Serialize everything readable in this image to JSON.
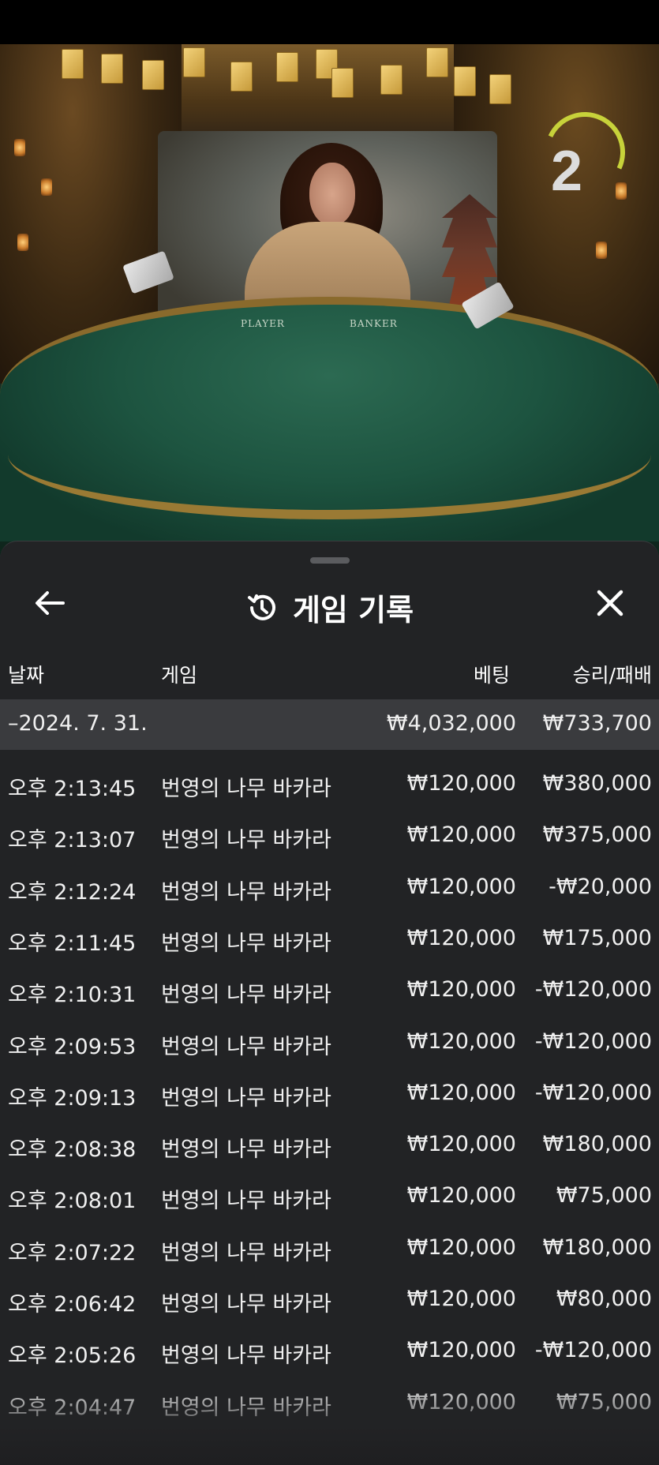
{
  "video": {
    "countdown": "2",
    "table_player_label": "PLAYER",
    "table_banker_label": "BANKER"
  },
  "panel": {
    "title": "게임 기록",
    "icons": {
      "back": "arrow-left-icon",
      "history": "history-icon",
      "close": "close-icon"
    },
    "columns": {
      "date": "날짜",
      "game": "게임",
      "bet": "베팅",
      "result": "승리/패배"
    },
    "summary": {
      "date": "–2024. 7. 31.",
      "bet": "₩4,032,000",
      "result": "₩733,700"
    },
    "rows": [
      {
        "time": "오후 2:13:45",
        "game": "번영의 나무 바카라",
        "bet": "₩120,000",
        "result": "₩380,000"
      },
      {
        "time": "오후 2:13:07",
        "game": "번영의 나무 바카라",
        "bet": "₩120,000",
        "result": "₩375,000"
      },
      {
        "time": "오후 2:12:24",
        "game": "번영의 나무 바카라",
        "bet": "₩120,000",
        "result": "-₩20,000"
      },
      {
        "time": "오후 2:11:45",
        "game": "번영의 나무 바카라",
        "bet": "₩120,000",
        "result": "₩175,000"
      },
      {
        "time": "오후 2:10:31",
        "game": "번영의 나무 바카라",
        "bet": "₩120,000",
        "result": "-₩120,000"
      },
      {
        "time": "오후 2:09:53",
        "game": "번영의 나무 바카라",
        "bet": "₩120,000",
        "result": "-₩120,000"
      },
      {
        "time": "오후 2:09:13",
        "game": "번영의 나무 바카라",
        "bet": "₩120,000",
        "result": "-₩120,000"
      },
      {
        "time": "오후 2:08:38",
        "game": "번영의 나무 바카라",
        "bet": "₩120,000",
        "result": "₩180,000"
      },
      {
        "time": "오후 2:08:01",
        "game": "번영의 나무 바카라",
        "bet": "₩120,000",
        "result": "₩75,000"
      },
      {
        "time": "오후 2:07:22",
        "game": "번영의 나무 바카라",
        "bet": "₩120,000",
        "result": "₩180,000"
      },
      {
        "time": "오후 2:06:42",
        "game": "번영의 나무 바카라",
        "bet": "₩120,000",
        "result": "₩80,000"
      },
      {
        "time": "오후 2:05:26",
        "game": "번영의 나무 바카라",
        "bet": "₩120,000",
        "result": "-₩120,000"
      },
      {
        "time": "오후 2:04:47",
        "game": "번영의 나무 바카라",
        "bet": "₩120,000",
        "result": "₩75,000"
      }
    ]
  },
  "colors": {
    "panel_bg": "#222325",
    "summary_bg": "#3a3b3e",
    "text": "#f0f0f0",
    "countdown_arc": "#c7d23a"
  }
}
